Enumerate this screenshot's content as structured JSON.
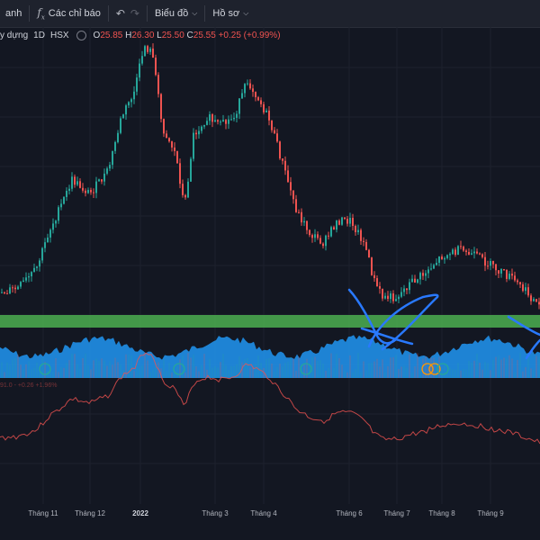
{
  "toolbar": {
    "left_fragment": "anh",
    "indicators_label": "Các chỉ báo",
    "chart_type_label": "Biểu đồ",
    "profile_label": "Hồ sơ",
    "fx_icon": "fx-icon",
    "undo_icon": "undo-icon",
    "redo_icon": "redo-icon"
  },
  "legend": {
    "symbol_name": "y dựng",
    "interval": "1D",
    "exchange": "HSX",
    "open_label": "O",
    "open_value": "25.85",
    "high_label": "H",
    "high_value": "26.30",
    "low_label": "L",
    "low_value": "25.50",
    "close_label": "C",
    "close_value": "25.55",
    "change": "+0.25 (+0.99%)"
  },
  "indicator_legend": "91.0 -  +0.26  +1.96%",
  "x_axis": {
    "labels": [
      {
        "text": "Tháng 11",
        "pos": 48,
        "bold": false
      },
      {
        "text": "Tháng 12",
        "pos": 100,
        "bold": false
      },
      {
        "text": "2022",
        "pos": 156,
        "bold": true
      },
      {
        "text": "Tháng 3",
        "pos": 239,
        "bold": false
      },
      {
        "text": "Tháng 4",
        "pos": 293,
        "bold": false
      },
      {
        "text": "Tháng 6",
        "pos": 388,
        "bold": false
      },
      {
        "text": "Tháng 7",
        "pos": 441,
        "bold": false
      },
      {
        "text": "Tháng 8",
        "pos": 491,
        "bold": false
      },
      {
        "text": "Tháng 9",
        "pos": 545,
        "bold": false
      }
    ]
  },
  "colors": {
    "background": "#131722",
    "up": "#26a69a",
    "down": "#ef5350",
    "support_zone": "#4caf50",
    "volume": "#2962ff",
    "drawing": "#2979ff"
  }
}
